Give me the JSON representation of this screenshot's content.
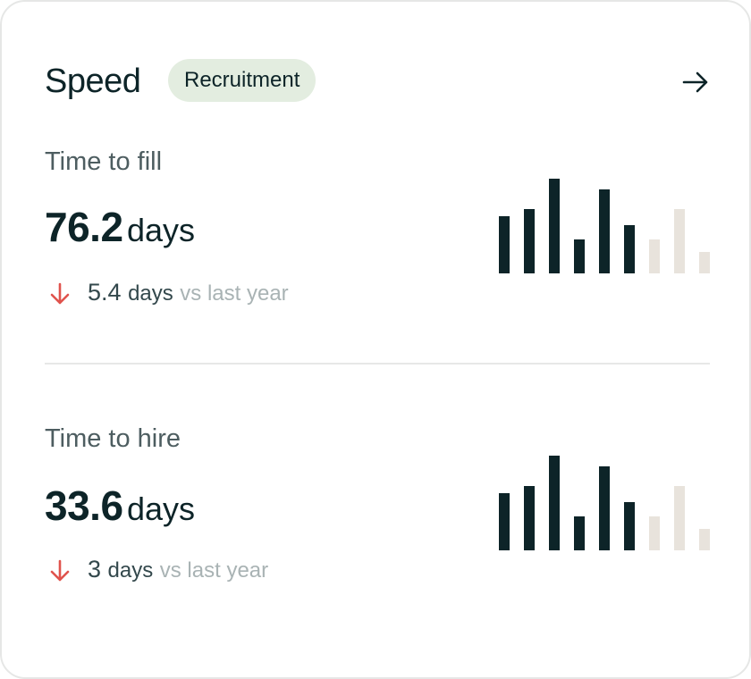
{
  "header": {
    "title": "Speed",
    "badge": "Recruitment",
    "arrow_icon": "arrow-right-icon"
  },
  "colors": {
    "bar_active": "#0d2428",
    "bar_inactive": "#e8e3dc",
    "down_arrow": "#e0534d",
    "badge_bg": "#e3ede0"
  },
  "metrics": [
    {
      "label": "Time to fill",
      "value": "76.2",
      "unit": "days",
      "delta_icon": "arrow-down-icon",
      "delta_value": "5.4",
      "delta_unit": "days",
      "delta_suffix": "vs last year"
    },
    {
      "label": "Time to hire",
      "value": "33.6",
      "unit": "days",
      "delta_icon": "arrow-down-icon",
      "delta_value": "3",
      "delta_unit": "days",
      "delta_suffix": "vs last year"
    }
  ],
  "chart_data": [
    {
      "type": "bar",
      "values": [
        64,
        72,
        106,
        38,
        94,
        54,
        38,
        72,
        24
      ],
      "highlighted": [
        true,
        true,
        true,
        true,
        true,
        true,
        false,
        false,
        false
      ],
      "ylim": [
        0,
        106
      ]
    },
    {
      "type": "bar",
      "values": [
        64,
        72,
        106,
        38,
        94,
        54,
        38,
        72,
        24
      ],
      "highlighted": [
        true,
        true,
        true,
        true,
        true,
        true,
        false,
        false,
        false
      ],
      "ylim": [
        0,
        106
      ]
    }
  ]
}
